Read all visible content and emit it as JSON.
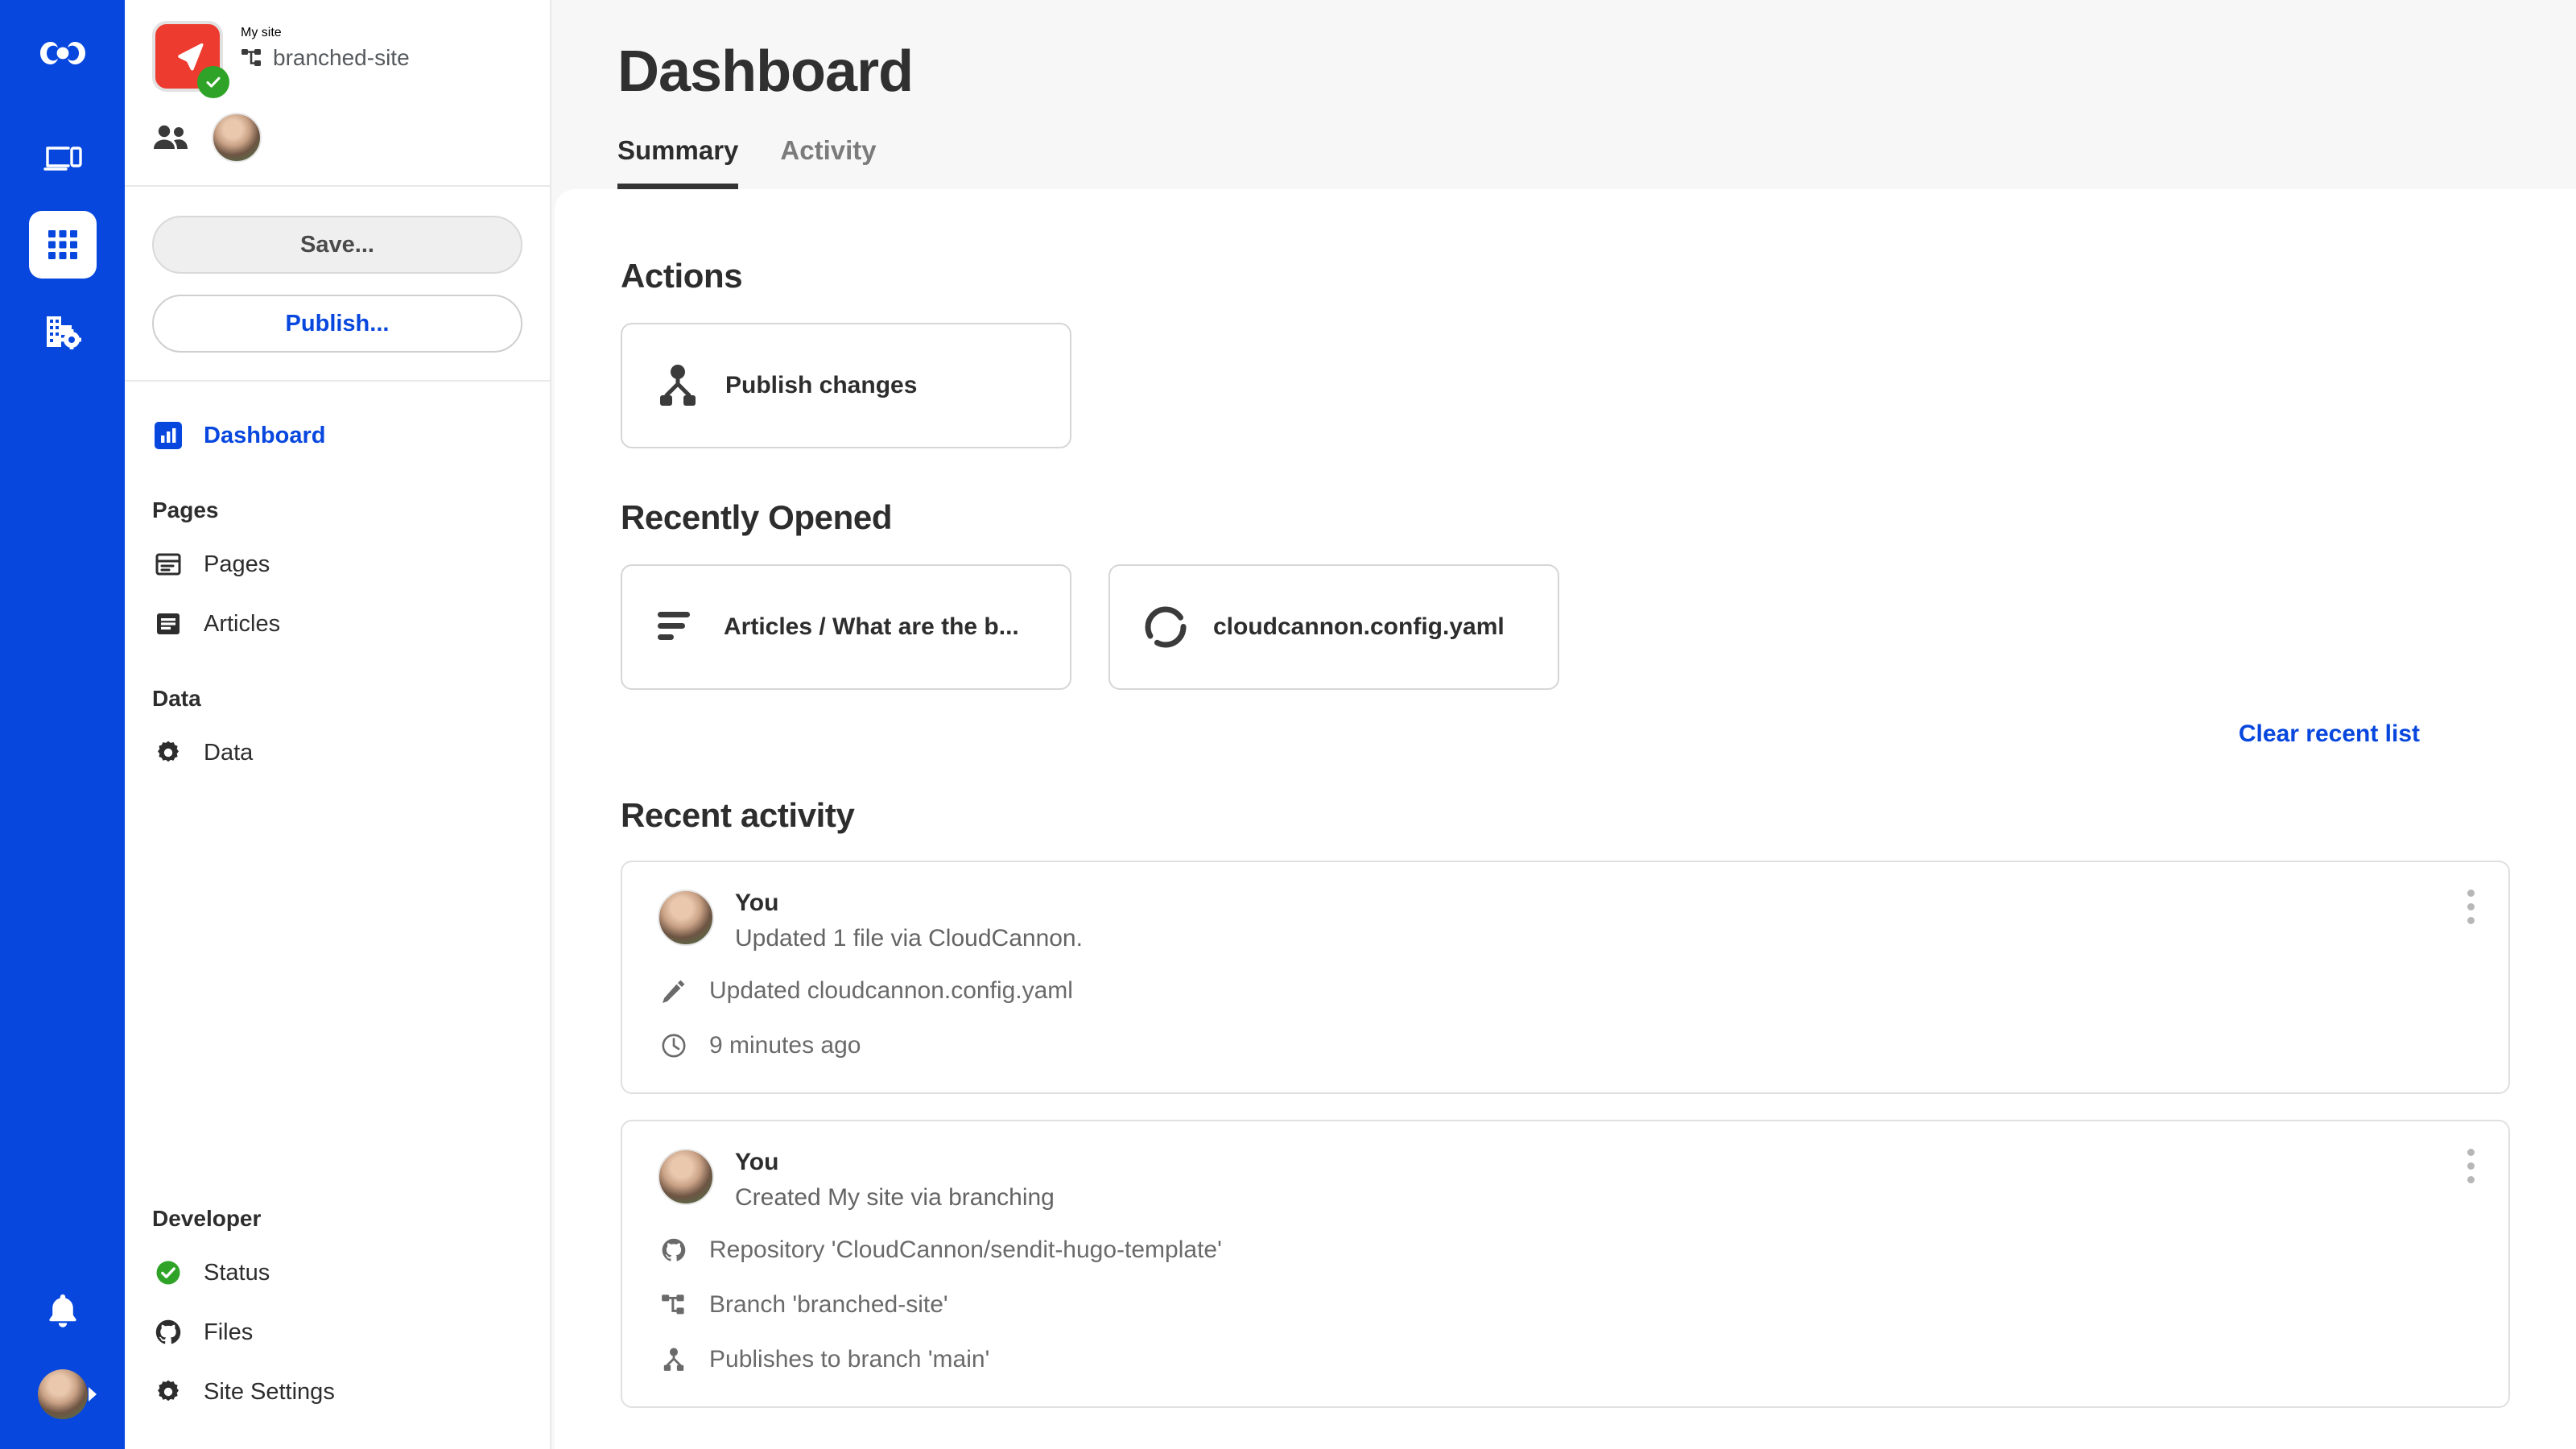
{
  "theme": {
    "brand_blue": "#0747DE",
    "site_logo_red": "#ED3B2F",
    "status_green": "#2FA327",
    "text_dark": "#2d2d2d",
    "text_muted": "#6a6a6a",
    "panel_bg": "#f7f7f7"
  },
  "rail": {
    "logo_icon": "cloudcannon-logo-icon",
    "items": [
      {
        "icon": "devices-preview-icon",
        "active": false
      },
      {
        "icon": "grid-apps-icon",
        "active": true
      },
      {
        "icon": "organisation-settings-icon",
        "active": false
      }
    ],
    "notifications_icon": "bell-icon",
    "account_icon": "user-avatar",
    "expand_icon": "caret-right-icon"
  },
  "sidebar": {
    "site": {
      "name": "My site",
      "branch": "branched-site",
      "branch_icon": "branch-icon",
      "logo_icon": "paper-plane-icon",
      "status_icon": "check-circle-icon"
    },
    "people": {
      "team_icon": "people-icon",
      "avatar": "user-avatar"
    },
    "buttons": {
      "save_label": "Save...",
      "publish_label": "Publish..."
    },
    "nav": [
      {
        "label": "Dashboard",
        "icon": "dashboard-chart-icon",
        "active": true
      }
    ],
    "groups": [
      {
        "title": "Pages",
        "items": [
          {
            "label": "Pages",
            "icon": "page-icon"
          },
          {
            "label": "Articles",
            "icon": "article-icon"
          }
        ]
      },
      {
        "title": "Data",
        "items": [
          {
            "label": "Data",
            "icon": "gear-icon"
          }
        ]
      }
    ],
    "developer": {
      "title": "Developer",
      "items": [
        {
          "label": "Status",
          "icon": "status-check-icon"
        },
        {
          "label": "Files",
          "icon": "github-icon"
        },
        {
          "label": "Site Settings",
          "icon": "gear-icon"
        }
      ]
    }
  },
  "main": {
    "title": "Dashboard",
    "tabs": [
      {
        "label": "Summary",
        "active": true
      },
      {
        "label": "Activity",
        "active": false
      }
    ],
    "actions": {
      "heading": "Actions",
      "items": [
        {
          "label": "Publish changes",
          "icon": "publish-merge-icon"
        }
      ]
    },
    "recently_opened": {
      "heading": "Recently Opened",
      "items": [
        {
          "label": "Articles / What are the b...",
          "icon": "article-lines-icon"
        },
        {
          "label": "cloudcannon.config.yaml",
          "icon": "config-ring-icon"
        }
      ],
      "clear_label": "Clear recent list"
    },
    "recent_activity": {
      "heading": "Recent activity",
      "entries": [
        {
          "author": "You",
          "summary": "Updated 1 file via CloudCannon.",
          "menu_icon": "more-vertical-icon",
          "details": [
            {
              "icon": "pencil-icon",
              "text": "Updated cloudcannon.config.yaml"
            },
            {
              "icon": "clock-icon",
              "text": "9 minutes ago"
            }
          ]
        },
        {
          "author": "You",
          "summary": "Created My site via branching",
          "menu_icon": "more-vertical-icon",
          "details": [
            {
              "icon": "github-icon",
              "text": "Repository 'CloudCannon/sendit-hugo-template'"
            },
            {
              "icon": "branch-icon",
              "text": "Branch 'branched-site'"
            },
            {
              "icon": "publish-merge-icon",
              "text": "Publishes to branch 'main'"
            }
          ]
        }
      ]
    }
  }
}
